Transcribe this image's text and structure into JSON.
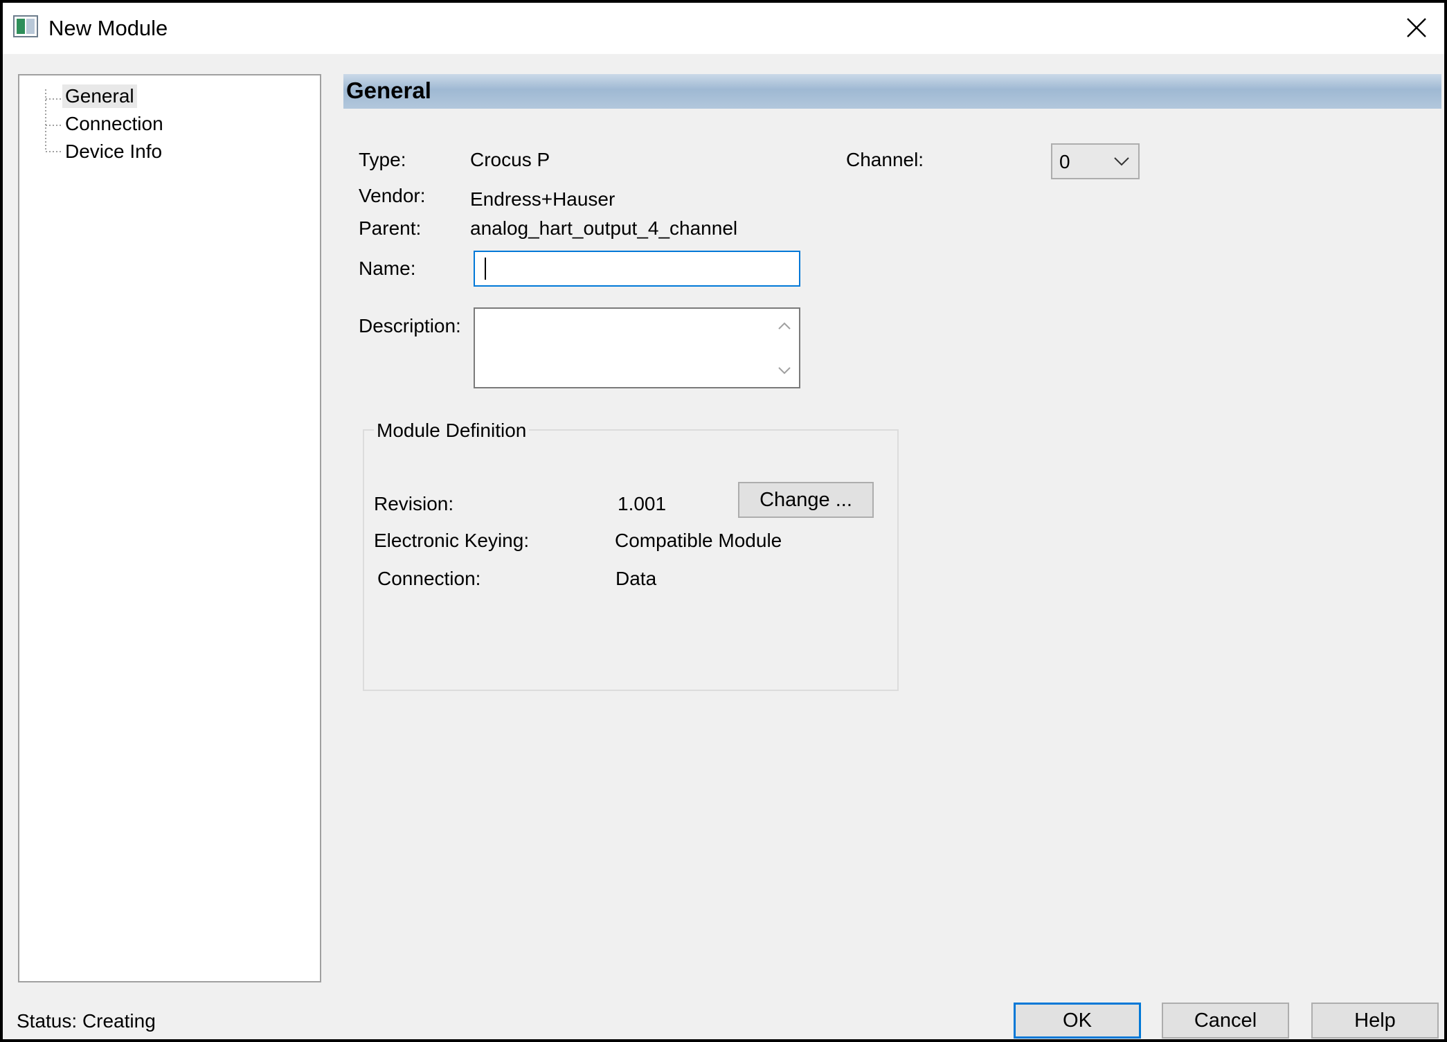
{
  "window": {
    "title": "New Module"
  },
  "tree": {
    "items": [
      {
        "label": "General",
        "selected": true
      },
      {
        "label": "Connection",
        "selected": false
      },
      {
        "label": "Device Info",
        "selected": false
      }
    ]
  },
  "section": {
    "title": "General"
  },
  "fields": {
    "type_label": "Type:",
    "type_value": "Crocus P",
    "vendor_label": "Vendor:",
    "vendor_value": "Endress+Hauser",
    "parent_label": "Parent:",
    "parent_value": "analog_hart_output_4_channel",
    "name_label": "Name:",
    "name_value": "",
    "description_label": "Description:",
    "description_value": "",
    "channel_label": "Channel:",
    "channel_value": "0"
  },
  "module_definition": {
    "title": "Module Definition",
    "revision_label": "Revision:",
    "revision_value": "1.001",
    "change_button": "Change ...",
    "keying_label": "Electronic Keying:",
    "keying_value": "Compatible Module",
    "connection_label": "Connection:",
    "connection_value": "Data"
  },
  "footer": {
    "status": "Status:  Creating",
    "ok": "OK",
    "cancel": "Cancel",
    "help": "Help"
  },
  "colors": {
    "accent": "#0078d7",
    "header_gradient": "#9fb9d3"
  }
}
